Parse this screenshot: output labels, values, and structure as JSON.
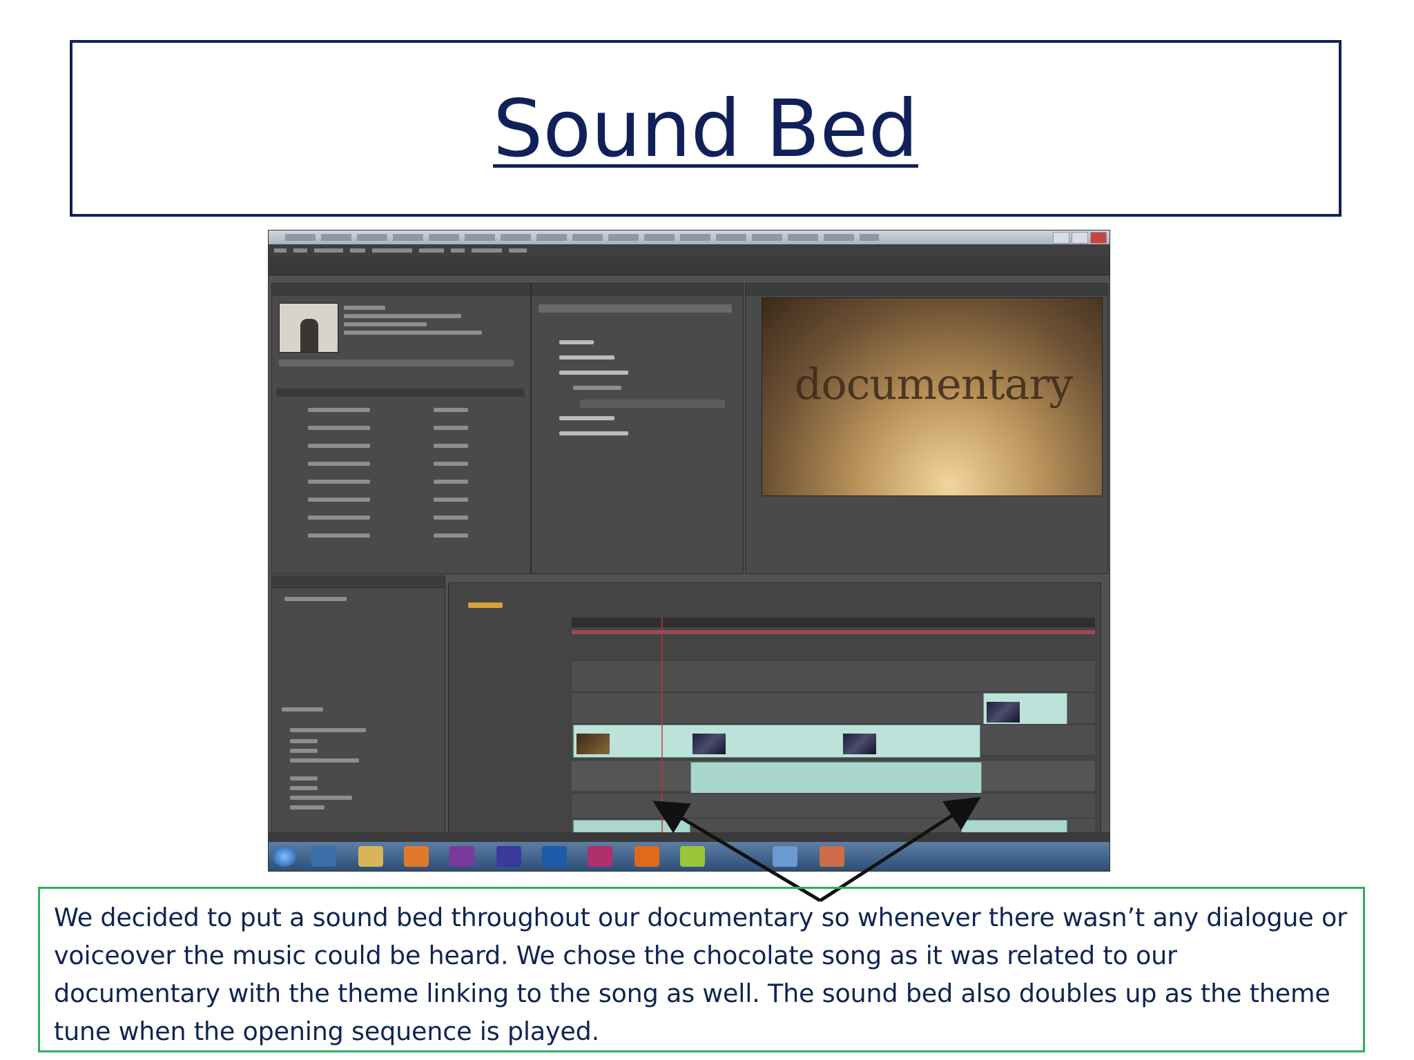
{
  "slide": {
    "title": "Sound Bed",
    "caption": "We decided to put a sound bed throughout our documentary so whenever there wasn’t any dialogue or voiceover the music could be heard. We chose the chocolate song as it was related to our documentary with the theme linking to the song as well. The sound bed also doubles up as the theme tune when the opening sequence is played."
  },
  "screenshot": {
    "monitor_text": "documentary"
  },
  "colors": {
    "title": "#10215a",
    "caption_text": "#0f2452",
    "caption_border": "#2fae5c"
  }
}
